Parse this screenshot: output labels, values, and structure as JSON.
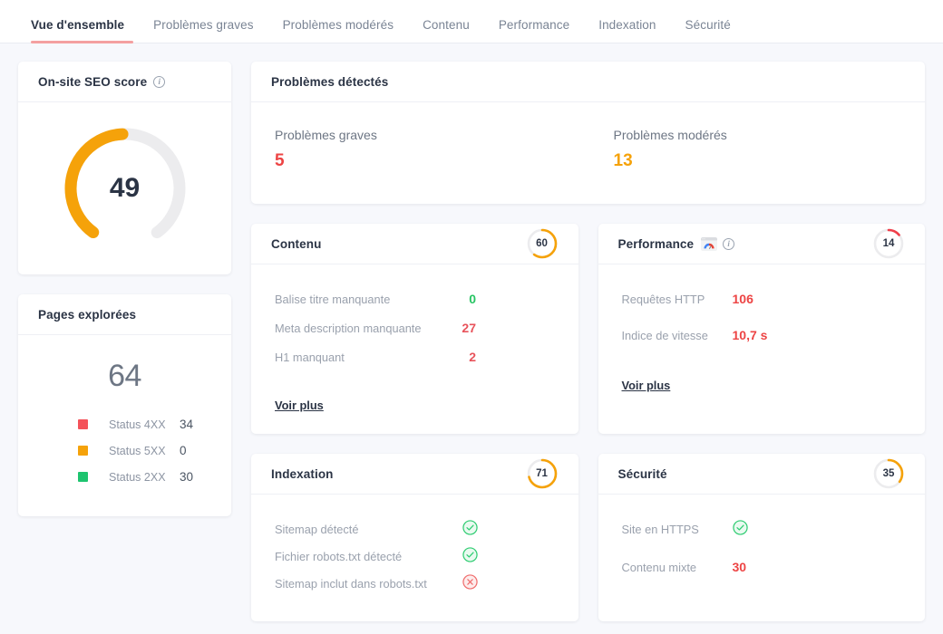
{
  "colors": {
    "orange": "#f5a20a",
    "red": "#ed4444",
    "red_soft": "#e8535b",
    "green": "#27c463",
    "track": "#ececee",
    "accent_tab": "#f4a0a0",
    "background": "#f7f8fc"
  },
  "tabs": [
    {
      "label": "Vue d'ensemble",
      "active": true
    },
    {
      "label": "Problèmes graves",
      "active": false
    },
    {
      "label": "Problèmes modérés",
      "active": false
    },
    {
      "label": "Contenu",
      "active": false
    },
    {
      "label": "Performance",
      "active": false
    },
    {
      "label": "Indexation",
      "active": false
    },
    {
      "label": "Sécurité",
      "active": false
    }
  ],
  "seo_score": {
    "title": "On-site SEO score",
    "info_icon": "info-icon",
    "value": "49",
    "score": 49,
    "arc_color": "#f5a20a"
  },
  "pages_crawled": {
    "title": "Pages explorées",
    "total": "64",
    "legend": [
      {
        "label": "Status 4XX",
        "value": "34",
        "color": "#f4535a"
      },
      {
        "label": "Status 5XX",
        "value": "0",
        "color": "#f5a20a"
      },
      {
        "label": "Status 2XX",
        "value": "30",
        "color": "#1ec46f"
      }
    ]
  },
  "issues": {
    "title": "Problèmes détectés",
    "items": [
      {
        "label": "Problèmes graves",
        "value": "5",
        "color": "#ed4444"
      },
      {
        "label": "Problèmes modérés",
        "value": "13",
        "color": "#f5a20a"
      }
    ]
  },
  "contenu": {
    "title": "Contenu",
    "gauge": {
      "value": "60",
      "score": 60,
      "color": "#f5a20a"
    },
    "rows": [
      {
        "label": "Balise titre manquante",
        "value": "0",
        "color": "#27c463"
      },
      {
        "label": "Meta description manquante",
        "value": "27",
        "color": "#e8535b"
      },
      {
        "label": "H1 manquant",
        "value": "2",
        "color": "#e8535b"
      }
    ],
    "link": "Voir plus"
  },
  "performance": {
    "title": "Performance",
    "psi_icon": "pagespeed-insights-icon",
    "info_icon": "info-icon",
    "gauge": {
      "value": "14",
      "score": 14,
      "color": "#ef3f4a"
    },
    "rows": [
      {
        "label": "Requêtes HTTP",
        "value": "106",
        "color": "#ed4444"
      },
      {
        "label": "Indice de vitesse",
        "value": "10,7 s",
        "color": "#ed4444"
      }
    ],
    "link": "Voir plus"
  },
  "indexation": {
    "title": "Indexation",
    "gauge": {
      "value": "71",
      "score": 71,
      "color": "#f5a20a"
    },
    "rows": [
      {
        "label": "Sitemap détecté",
        "status": "check",
        "icon": "check-circle-icon"
      },
      {
        "label": "Fichier robots.txt détecté",
        "status": "check",
        "icon": "check-circle-icon"
      },
      {
        "label": "Sitemap inclut dans robots.txt",
        "status": "cross",
        "icon": "cross-circle-icon"
      }
    ]
  },
  "securite": {
    "title": "Sécurité",
    "gauge": {
      "value": "35",
      "score": 35,
      "color": "#f5a20a"
    },
    "rows": [
      {
        "label": "Site en HTTPS",
        "status": "check",
        "icon": "check-circle-icon",
        "value": ""
      },
      {
        "label": "Contenu mixte",
        "status": "value",
        "value": "30",
        "color": "#ed4444"
      }
    ]
  },
  "chart_data": {
    "type": "gauge-collection",
    "title": "On-site SEO audit scores",
    "gauges": [
      {
        "name": "On-site SEO score",
        "value": 49,
        "max": 100,
        "color": "#f5a20a"
      },
      {
        "name": "Contenu",
        "value": 60,
        "max": 100,
        "color": "#f5a20a"
      },
      {
        "name": "Performance",
        "value": 14,
        "max": 100,
        "color": "#ef3f4a"
      },
      {
        "name": "Indexation",
        "value": 71,
        "max": 100,
        "color": "#f5a20a"
      },
      {
        "name": "Sécurité",
        "value": 35,
        "max": 100,
        "color": "#f5a20a"
      }
    ],
    "pages_breakdown": {
      "type": "table",
      "total": 64,
      "categories": [
        "Status 4XX",
        "Status 5XX",
        "Status 2XX"
      ],
      "values": [
        34,
        0,
        30
      ]
    },
    "issues_breakdown": {
      "type": "table",
      "categories": [
        "Problèmes graves",
        "Problèmes modérés"
      ],
      "values": [
        5,
        13
      ]
    }
  }
}
